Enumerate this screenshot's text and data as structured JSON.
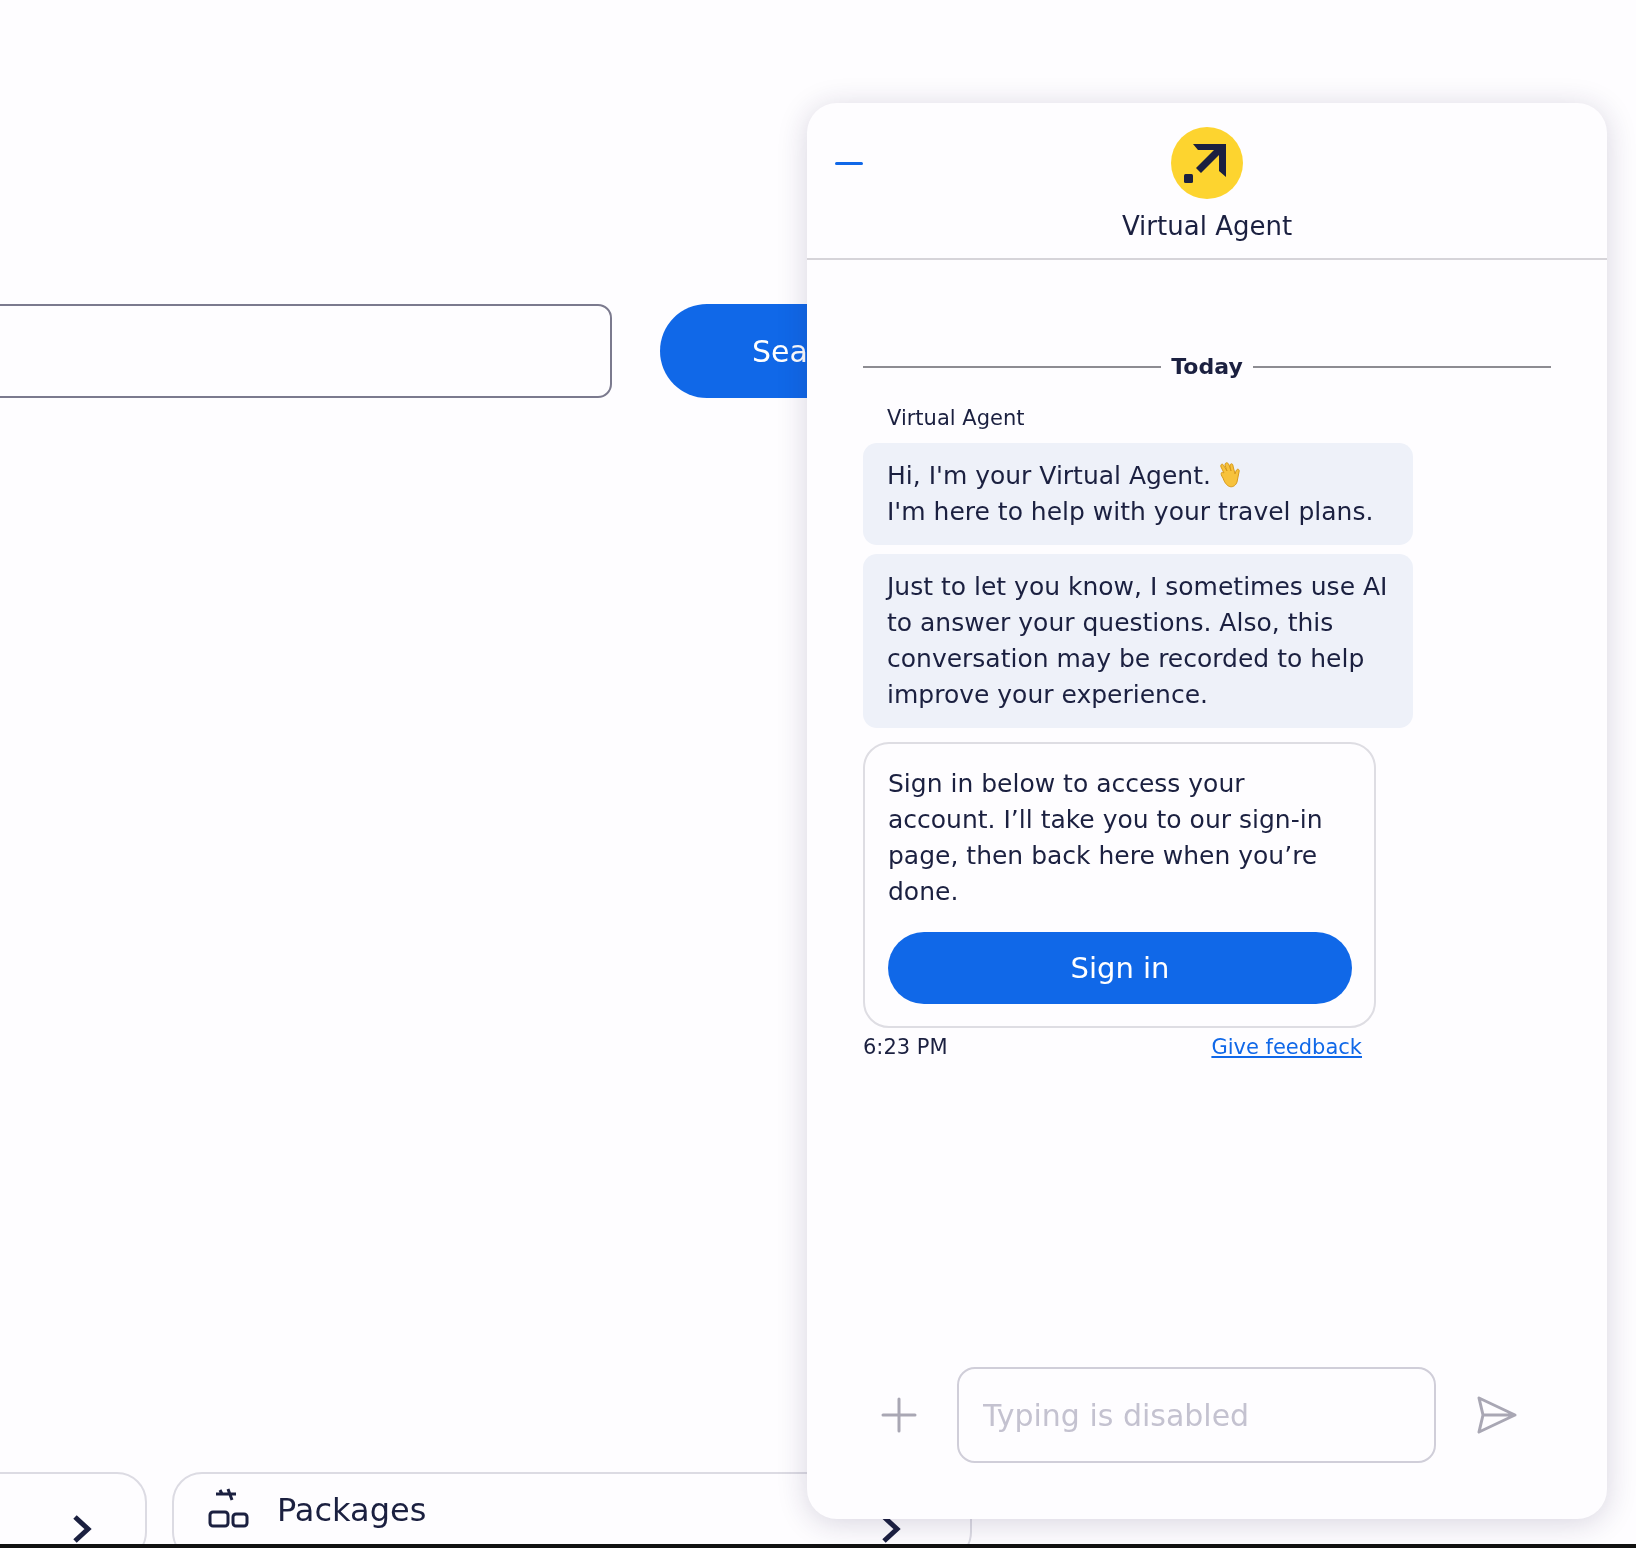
{
  "background_page": {
    "search_button": {
      "label": "Sea"
    },
    "cards": [
      {
        "kind": "plain"
      },
      {
        "kind": "labeled",
        "label": "Packages"
      }
    ]
  },
  "chat": {
    "title": "Virtual Agent",
    "date_divider": "Today",
    "sender": "Virtual Agent",
    "messages": [
      {
        "kind": "greeting",
        "text": "Hi, I'm your Virtual Agent.",
        "text_2": "I'm here to help with your travel plans."
      },
      {
        "kind": "text",
        "text": "Just to let you know, I sometimes use AI to answer your questions. Also, this conversation may be recorded to help improve your experience."
      },
      {
        "kind": "card",
        "text": "Sign in below to access your account. I’ll take you to our sign-in page, then back here when you’re done.",
        "button": "Sign in"
      }
    ],
    "time": "6:23 PM",
    "feedback_link": "Give feedback",
    "composer": {
      "placeholder": "Typing is disabled",
      "disabled": true
    }
  }
}
